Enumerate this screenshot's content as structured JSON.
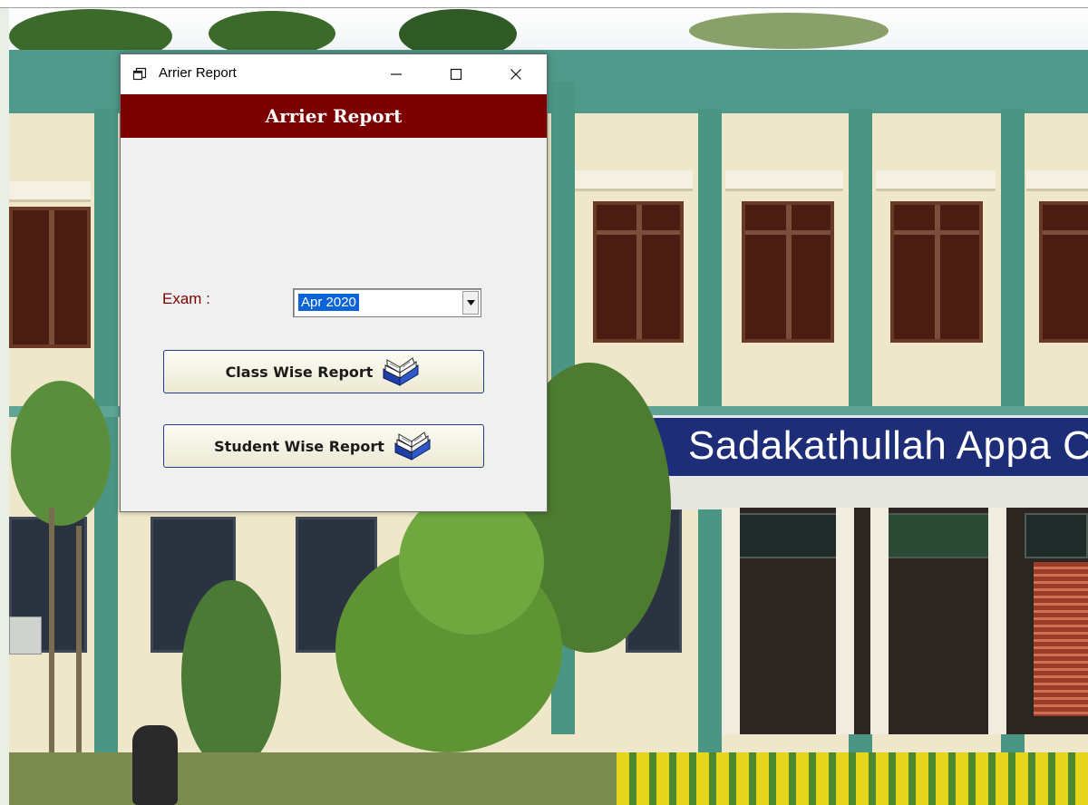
{
  "window": {
    "title": "Arrier Report",
    "minimize_glyph": "—",
    "maximize_glyph": "☐",
    "close_glyph": "✕"
  },
  "header": {
    "title": "Arrier Report"
  },
  "exam": {
    "label": "Exam :",
    "selected": "Apr 2020"
  },
  "buttons": {
    "class_wise": "Class Wise Report",
    "student_wise": "Student Wise Report"
  },
  "background": {
    "sign_text": "Sadakathullah Appa Co"
  },
  "icons": {
    "window_icon": "window-restore-icon",
    "button_icon": "open-book-icon",
    "dropdown_icon": "chevron-down-icon"
  },
  "colors": {
    "banner": "#7c0000",
    "label": "#7c0000",
    "selection": "#0a64d8",
    "button_border": "#1e3e8a"
  }
}
